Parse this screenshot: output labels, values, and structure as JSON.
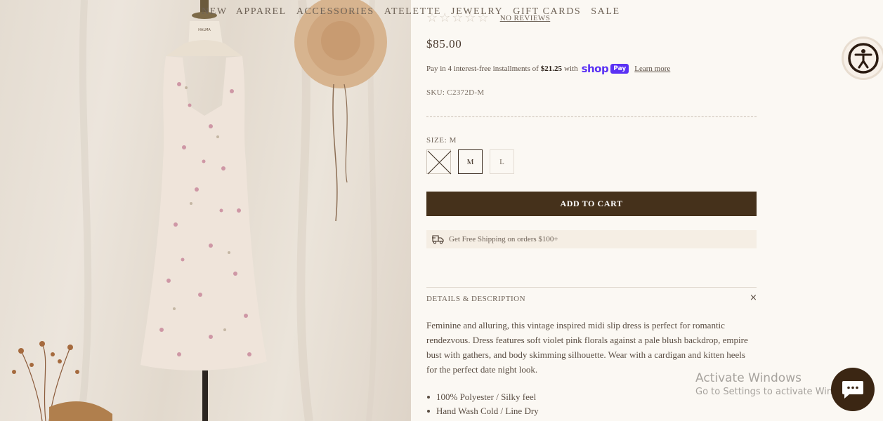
{
  "nav": {
    "items": [
      "NEW",
      "APPAREL",
      "ACCESSORIES",
      "ATELETTE",
      "JEWELRY",
      "GIFT CARDS",
      "SALE"
    ]
  },
  "product": {
    "stars_glyphs": "☆☆☆☆☆",
    "rating": 0,
    "reviews_link": "NO REVIEWS",
    "price": "$85.00",
    "installments": {
      "prefix": "Pay in 4 interest-free installments of",
      "amount": "$21.25",
      "suffix": "with",
      "brand": "shop",
      "badge": "Pay",
      "learn_more": "Learn more"
    },
    "sku": "SKU: C2372D-M",
    "size_label": "SIZE:",
    "size_value": "M",
    "sizes": [
      {
        "label": "",
        "state": "unavailable"
      },
      {
        "label": "M",
        "state": "selected"
      },
      {
        "label": "L",
        "state": "available"
      }
    ],
    "add_to_cart": "ADD TO CART",
    "shipping_note": "Get Free Shipping on orders $100+",
    "details_title": "DETAILS & DESCRIPTION",
    "details_close": "×",
    "description": "Feminine and alluring, this vintage inspired midi slip dress is perfect for romantic rendezvous. Dress features soft violet pink florals against a pale blush backdrop, empire bust with gathers, and body skimming silhouette. Wear with a cardigan and kitten heels for the perfect date night look.",
    "bullets": [
      "100% Polyester / Silky feel",
      "Hand Wash Cold / Line Dry"
    ]
  },
  "watermark": {
    "line1": "Activate Windows",
    "line2": "Go to Settings to activate Windows."
  },
  "colors": {
    "background": "#fbf8f3",
    "button": "#45311b",
    "shop_pay": "#5a31f4",
    "chat_bubble": "#3b2613"
  },
  "icons": [
    "accessibility-icon",
    "chat-icon",
    "shipping-icon",
    "close-icon"
  ]
}
